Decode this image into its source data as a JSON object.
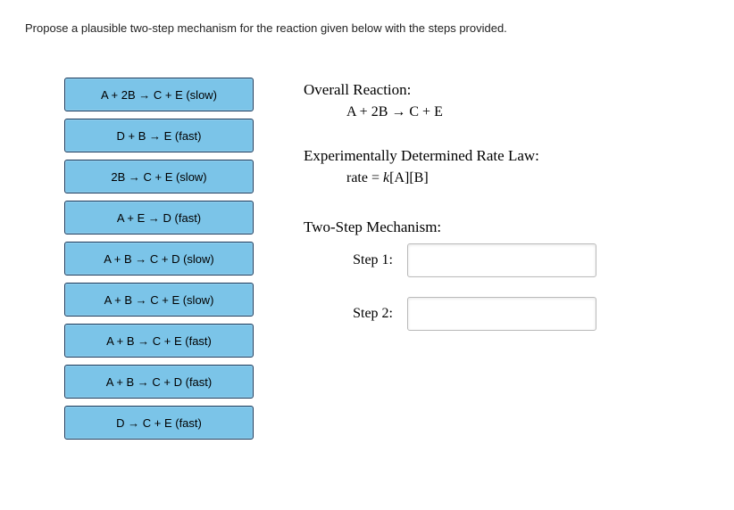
{
  "question": "Propose a plausible two-step mechanism for the reaction given below with the steps provided.",
  "options": [
    {
      "label": "A + 2B → C + E (slow)"
    },
    {
      "label": "D + B → E (fast)"
    },
    {
      "label": "2B → C + E (slow)"
    },
    {
      "label": "A + E → D (fast)"
    },
    {
      "label": "A + B → C + D (slow)"
    },
    {
      "label": "A + B → C + E (slow)"
    },
    {
      "label": "A + B → C + E (fast)"
    },
    {
      "label": "A + B → C + D (fast)"
    },
    {
      "label": "D → C + E (fast)"
    }
  ],
  "overall": {
    "title": "Overall Reaction:",
    "reaction": "A + 2B → C + E"
  },
  "ratelaw": {
    "title": "Experimentally Determined Rate Law:",
    "prefix": "rate = ",
    "k": "k",
    "expr": "[A][B]"
  },
  "mechanism": {
    "title": "Two-Step Mechanism:",
    "step1_label": "Step 1:",
    "step2_label": "Step 2:"
  }
}
